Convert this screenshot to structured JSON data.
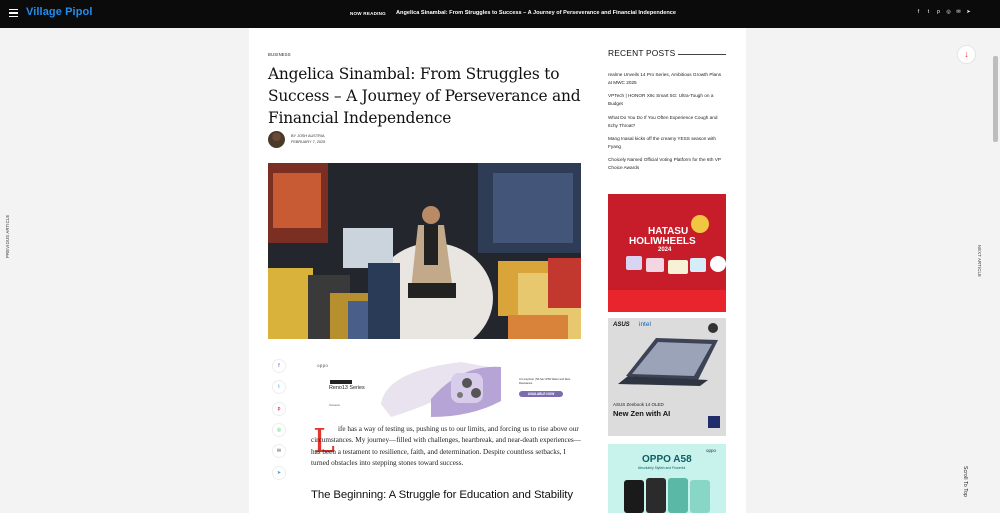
{
  "header": {
    "logo": "Village Pipol",
    "now_reading_label": "NOW READING",
    "now_reading_title": "Angelica Sinambal: From Struggles to Success – A Journey of Perseverance and Financial Independence",
    "social_icons": [
      "facebook-icon",
      "twitter-icon",
      "pinterest-icon",
      "whatsapp-icon",
      "email-icon",
      "telegram-icon"
    ]
  },
  "side": {
    "prev": "PREVIOUS ARTICLE",
    "next": "NEXT ARTICLE",
    "scroll_top": "Scroll To Top"
  },
  "article": {
    "category": "BUSINESS",
    "title": "Angelica Sinambal: From Struggles to Success – A Journey of Perseverance and Financial Independence",
    "author": "BY JOSH AUSTRIA",
    "date": "FEBRUARY 7, 2025",
    "dropcap": "L",
    "paragraph": "ife has a way of testing us, pushing us to our limits, and forcing us to rise above our circumstances. My journey—filled with challenges, heartbreak, and near-death experiences—has been a testament to resilience, faith, and determination. Despite countless setbacks, I turned obstacles into stepping stones toward success.",
    "heading": "The Beginning: A Struggle for Education and Stability"
  },
  "ad_banner": {
    "brand": "oppo",
    "new_badge": "",
    "model": "Reno13 Series",
    "credit": "Camera",
    "features": "AI Livephoto | 50-Sec IP69 Water and Dust Resistance",
    "cta": "AVAILABLE NOW"
  },
  "sidebar": {
    "title": "RECENT POSTS",
    "posts": [
      "realme Unveils 14 Pro Series, Ambitious Growth Plans at MWC 2025",
      "VPTech | HONOR X9c Smart 5G: Ultra-Tough on a Budget",
      "What Do You Do If You Often Experience Cough and Itchy Throat?",
      "Mang Inasal kicks off the creamy YESS season with Fyang",
      "Choicely Named Official Voting Platform for the 6th VP Choice Awards"
    ],
    "ads": {
      "hatasu_title": "HATASU",
      "hatasu_sub": "HOLIWHEELS",
      "hatasu_year": "2024",
      "asus_brand": "ASUS",
      "intel": "intel",
      "asus_product": "ASUS Zenbook 14 OLED",
      "asus_tagline": "New Zen with AI",
      "oppo_brand": "oppo",
      "oppo_model": "OPPO A58",
      "oppo_tag": "Absolutely Stylish and Powerful"
    }
  },
  "colors": {
    "accent": "#e2352b",
    "logo": "#1f8ef1",
    "topbar": "#0b0b0b"
  }
}
